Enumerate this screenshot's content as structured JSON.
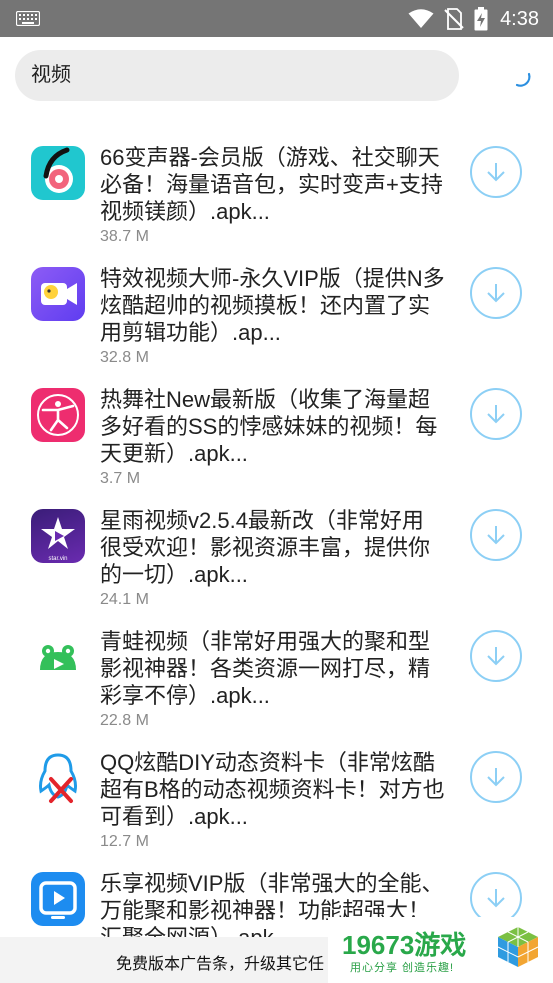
{
  "status": {
    "time": "4:38"
  },
  "search": {
    "query": "视频"
  },
  "items": [
    {
      "title": "66变声器-会员版（游戏、社交聊天\n必备！海量语音包，实时变声+支持\n视频镁颜）.apk...",
      "size": "38.7 M",
      "icon": "voice-changer-66-icon"
    },
    {
      "title": "特效视频大师-永久VIP版（提供N多\n炫酷超帅的视频摸板！还内置了实\n用剪辑功能）.ap...",
      "size": "32.8 M",
      "icon": "video-master-icon"
    },
    {
      "title": "热舞社New最新版（收集了海量超\n多好看的SS的悖感妹妹的视频！每\n天更新）.apk...",
      "size": "3.7 M",
      "icon": "dancer-icon"
    },
    {
      "title": "星雨视频v2.5.4最新改（非常好用\n很受欢迎！影视资源丰富，提供你\n的一切）.apk...",
      "size": "24.1 M",
      "icon": "star-rain-icon",
      "icon_text": "star.vin"
    },
    {
      "title": "青蛙视频（非常好用强大的聚和型\n影视神器！各类资源一网打尽，精\n彩享不停）.apk...",
      "size": "22.8 M",
      "icon": "frog-icon"
    },
    {
      "title": "QQ炫酷DIY动态资料卡（非常炫酷\n超有B格的动态视频资料卡！对方也\n可看到）.apk...",
      "size": "12.7 M",
      "icon": "qq-penguin-icon"
    },
    {
      "title": "乐享视频VIP版（非常强大的全能、\n万能聚和影视神器！功能超强大！\n汇聚全网源）.apk...",
      "size": "",
      "icon": "play-screen-icon"
    }
  ],
  "ad": {
    "text": "免费版本广告条，升级其它任"
  },
  "brand": {
    "name": "19673游戏",
    "slogan": "用心分享 创造乐趣!"
  },
  "colors": {
    "statusbar": "#757575",
    "accent": "#8ccff5",
    "brand": "#29a84a"
  }
}
